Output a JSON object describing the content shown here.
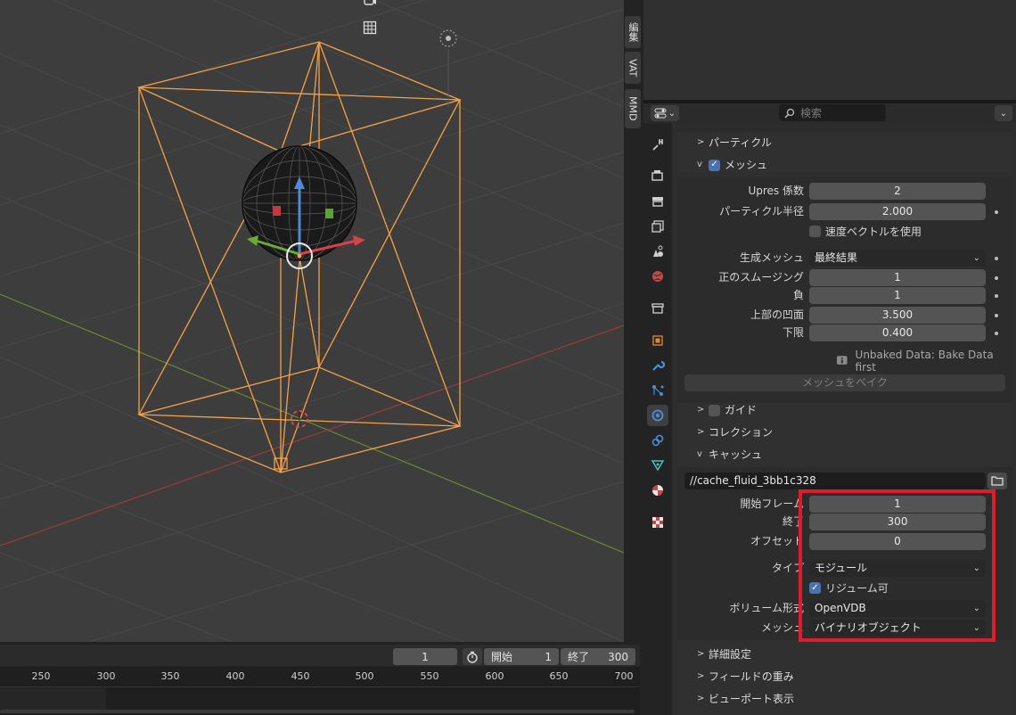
{
  "viewport": {
    "gizmo_icons": [
      "camera-icon",
      "grid-icon"
    ]
  },
  "side_tabs": [
    "編集",
    "VAT",
    "MMD"
  ],
  "properties": {
    "search_placeholder": "検索",
    "tabs": [
      "tool-icon",
      "render-icon",
      "output-icon",
      "view-layer-icon",
      "scene-icon",
      "world-icon",
      "collection-icon",
      "object-icon",
      "modifier-icon",
      "particles-icon",
      "physics-icon",
      "constraints-icon",
      "data-icon",
      "material-icon",
      "texture-icon"
    ],
    "panels": {
      "particles": "パーティクル",
      "mesh": {
        "title": "メッシュ",
        "checked": true,
        "upres_label": "Upres 係数",
        "upres_value": "2",
        "particle_radius_label": "パーティクル半径",
        "particle_radius_value": "2.000",
        "velocity_label": "速度ベクトルを使用",
        "velocity_checked": false,
        "generate_label": "生成メッシュ",
        "generate_value": "最終結果",
        "smooth_pos_label": "正のスムージング",
        "smooth_pos_value": "1",
        "smooth_neg_label": "負",
        "smooth_neg_value": "1",
        "concave_upper_label": "上部の凹面",
        "concave_upper_value": "3.500",
        "concave_lower_label": "下限",
        "concave_lower_value": "0.400",
        "unbaked_text": "Unbaked Data: Bake Data first",
        "bake_button": "メッシュをベイク"
      },
      "guides": "ガイド",
      "collections": "コレクション",
      "cache": {
        "title": "キャッシュ",
        "path": "//cache_fluid_3bb1c328",
        "frame_start_label": "開始フレーム",
        "frame_start_value": "1",
        "end_label": "終了",
        "end_value": "300",
        "offset_label": "オフセット",
        "offset_value": "0",
        "type_label": "タイプ",
        "type_value": "モジュール",
        "resumable_label": "リジューム可",
        "resumable_checked": true,
        "volume_format_label": "ボリューム形式",
        "volume_format_value": "OpenVDB",
        "mesh_label": "メッシュ",
        "mesh_value": "バイナリオブジェクト"
      },
      "advanced": "詳細設定",
      "field_weights": "フィールドの重み",
      "viewport_display": "ビューポート表示"
    }
  },
  "timeline": {
    "current_frame": "1",
    "start_label": "開始",
    "start_value": "1",
    "end_label": "終了",
    "end_value": "300",
    "ticks": [
      "250",
      "300",
      "350",
      "400",
      "450",
      "500",
      "550",
      "600",
      "650",
      "700"
    ]
  },
  "colors": {
    "selection_orange": "#f5a146",
    "highlight_red": "#e21b2b",
    "checkbox_blue": "#4772b3"
  }
}
